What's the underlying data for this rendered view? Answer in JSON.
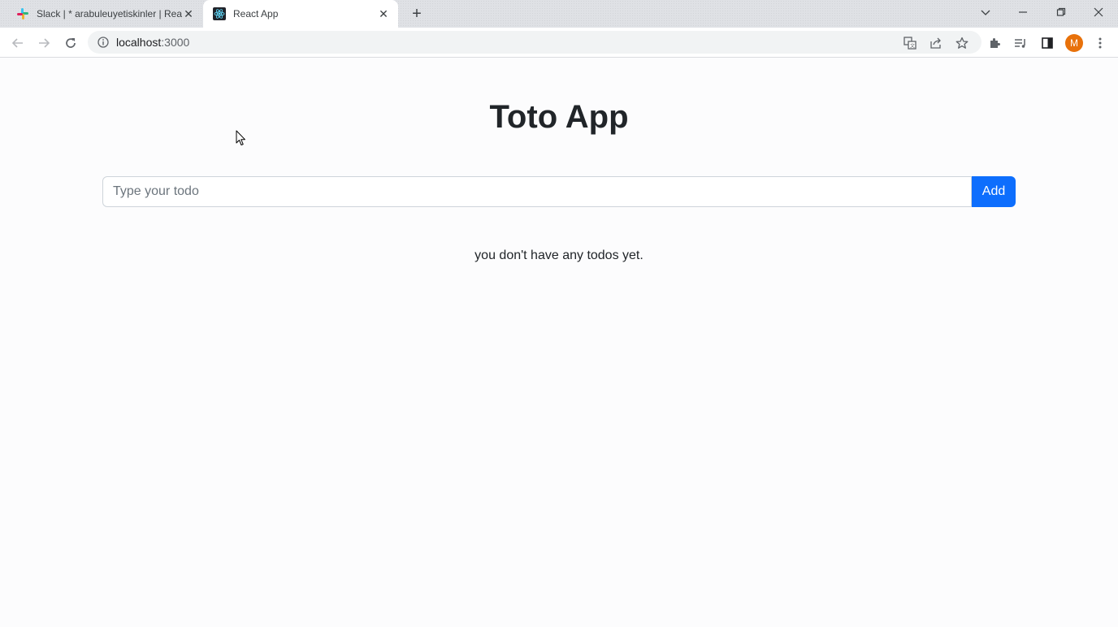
{
  "browser": {
    "tabs": [
      {
        "title": "Slack | * arabuleuyetiskinler | Rea",
        "favicon": "slack-icon",
        "active": false
      },
      {
        "title": "React App",
        "favicon": "react-icon",
        "active": true
      }
    ],
    "address": {
      "host": "localhost",
      "port": ":3000"
    }
  },
  "app": {
    "title": "Toto App",
    "input": {
      "placeholder": "Type your todo",
      "value": ""
    },
    "add_label": "Add",
    "empty_message": "you don't have any todos yet."
  },
  "colors": {
    "primary": "#0d6efd",
    "text": "#212529",
    "avatar": "#e8710a"
  },
  "profile": {
    "initial": "M"
  }
}
